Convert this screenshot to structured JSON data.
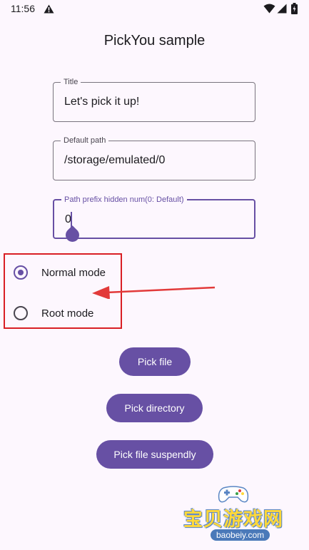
{
  "status_bar": {
    "time": "11:56",
    "icons": [
      "warning-icon",
      "wifi-icon",
      "cellular-signal-icon",
      "battery-icon"
    ]
  },
  "app": {
    "title": "PickYou sample"
  },
  "fields": {
    "title": {
      "label": "Title",
      "value": "Let's pick it up!"
    },
    "default_path": {
      "label": "Default path",
      "value": "/storage/emulated/0"
    },
    "path_prefix": {
      "label": "Path prefix hidden num(0: Default)",
      "value": "0"
    }
  },
  "mode": {
    "options": [
      {
        "label": "Normal mode",
        "selected": true
      },
      {
        "label": "Root mode",
        "selected": false
      }
    ]
  },
  "buttons": {
    "pick_file": "Pick file",
    "pick_directory": "Pick directory",
    "pick_file_suspendly": "Pick file suspendly"
  },
  "watermark": {
    "text": "宝贝游戏网",
    "url": "baobeiy.com"
  },
  "colors": {
    "primary": "#6750a4",
    "background": "#fdf7fe",
    "annotation_red": "#d91f25"
  }
}
